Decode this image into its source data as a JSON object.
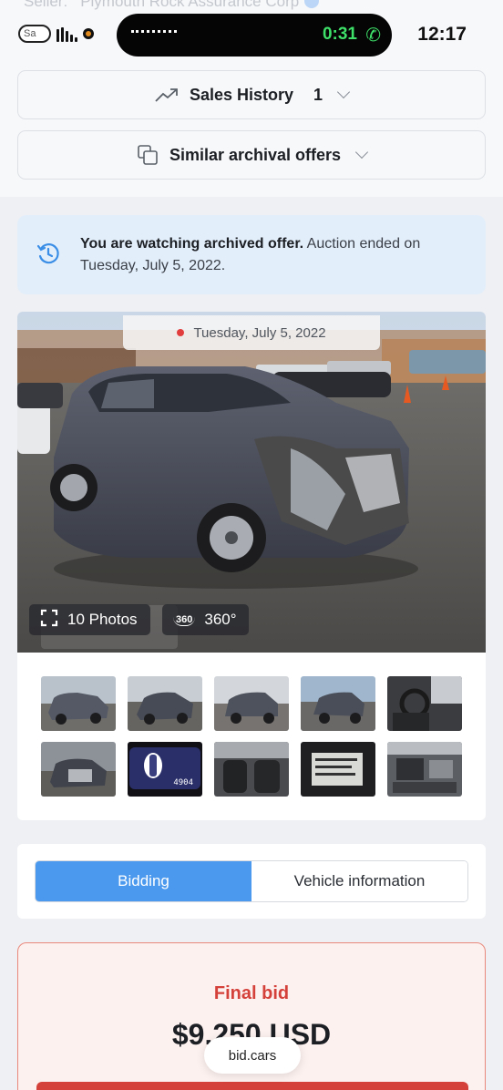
{
  "status_bar": {
    "seller_label": "Seller:",
    "seller_name": "Plymouth Rock Assurance Corp",
    "mini_pill_text": "Sa",
    "call_timer": "0:31",
    "clock": "12:17"
  },
  "sales_history": {
    "label": "Sales History",
    "count": "1"
  },
  "similar_offers": {
    "label": "Similar archival offers"
  },
  "notice": {
    "bold_text": "You are watching archived offer.",
    "text": " Auction ended on Tuesday, July 5, 2022."
  },
  "gallery": {
    "date_label": "Tuesday, July 5, 2022",
    "photos_button": "10 Photos",
    "tour_badge": "360",
    "tour_button": "360°",
    "thumbnails": [
      {
        "name": "thumb-front-damage"
      },
      {
        "name": "thumb-front-angle"
      },
      {
        "name": "thumb-rear-angle"
      },
      {
        "name": "thumb-rear-left"
      },
      {
        "name": "thumb-interior-driver"
      },
      {
        "name": "thumb-engine-front"
      },
      {
        "name": "thumb-odometer",
        "odometer": "4904"
      },
      {
        "name": "thumb-interior-seats"
      },
      {
        "name": "thumb-vin-label"
      },
      {
        "name": "thumb-engine-bay"
      }
    ]
  },
  "tabs": {
    "bidding": "Bidding",
    "vehicle_info": "Vehicle information"
  },
  "final_bid": {
    "title": "Final bid",
    "amount": "$9,250 USD"
  },
  "browser": {
    "url": "bid.cars"
  },
  "colors": {
    "accent": "#4a99ee",
    "bid_red": "#d4403a",
    "call_green": "#3ee069"
  }
}
